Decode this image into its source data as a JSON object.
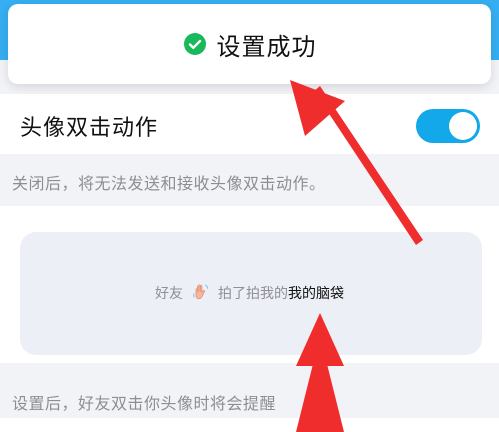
{
  "toast": {
    "text": "设置成功",
    "icon": "check-circle-icon"
  },
  "setting": {
    "label": "头像双击动作",
    "enabled": true
  },
  "descriptions": {
    "off_hint": "关闭后，将无法发送和接收头像双击动作。",
    "set_hint": "设置后，好友双击你头像时将会提醒"
  },
  "preview": {
    "friend_label": "好友",
    "action_text": "拍了拍我的",
    "target_text": "我的脑袋"
  },
  "colors": {
    "top_bar": "#36aef1",
    "toggle_on": "#13a8ea",
    "check_green": "#18b95b",
    "annotation_red": "#ef2d2d"
  }
}
